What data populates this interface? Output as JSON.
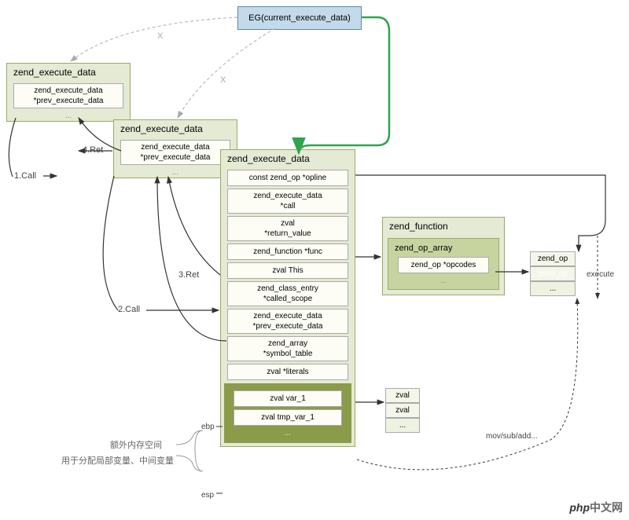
{
  "top": {
    "label": "EG(current_execute_data)"
  },
  "zed1": {
    "title": "zend_execute_data",
    "field1": "zend_execute_data\n*prev_execute_data",
    "ell": "..."
  },
  "zed2": {
    "title": "zend_execute_data",
    "field1": "zend_execute_data\n*prev_execute_data",
    "ell": "..."
  },
  "labels": {
    "call1": "1.Call",
    "call2": "2.Call",
    "ret3": "3.Ret",
    "ret4": "4.Ret",
    "x1": "X",
    "x2": "X",
    "ebp": "ebp",
    "esp": "esp",
    "movsub": "mov/sub/add...",
    "execute": "execute",
    "extra1": "额外内存空间",
    "extra2": "用于分配局部变量、中间变量"
  },
  "zed3": {
    "title": "zend_execute_data",
    "fields": [
      "const zend_op   *opline",
      "zend_execute_data\n*call",
      "zval\n*return_value",
      "zend_function       *func",
      "zval              This",
      "zend_class_entry\n*called_scope",
      "zend_execute_data\n*prev_execute_data",
      "zend_array\n*symbol_table",
      "zval           *literals"
    ],
    "vars": [
      "zval  var_1",
      "zval  tmp_var_1"
    ],
    "ell": "..."
  },
  "zfunc": {
    "title": "zend_function",
    "oparray": "zend_op_array",
    "opcodes": "zend_op *opcodes",
    "ell": "..."
  },
  "zops": {
    "items": [
      "zend_op",
      "zend_op",
      "..."
    ]
  },
  "zvals": {
    "items": [
      "zval",
      "zval",
      "..."
    ]
  },
  "watermark": {
    "php": "php",
    "cn": "中文网"
  }
}
